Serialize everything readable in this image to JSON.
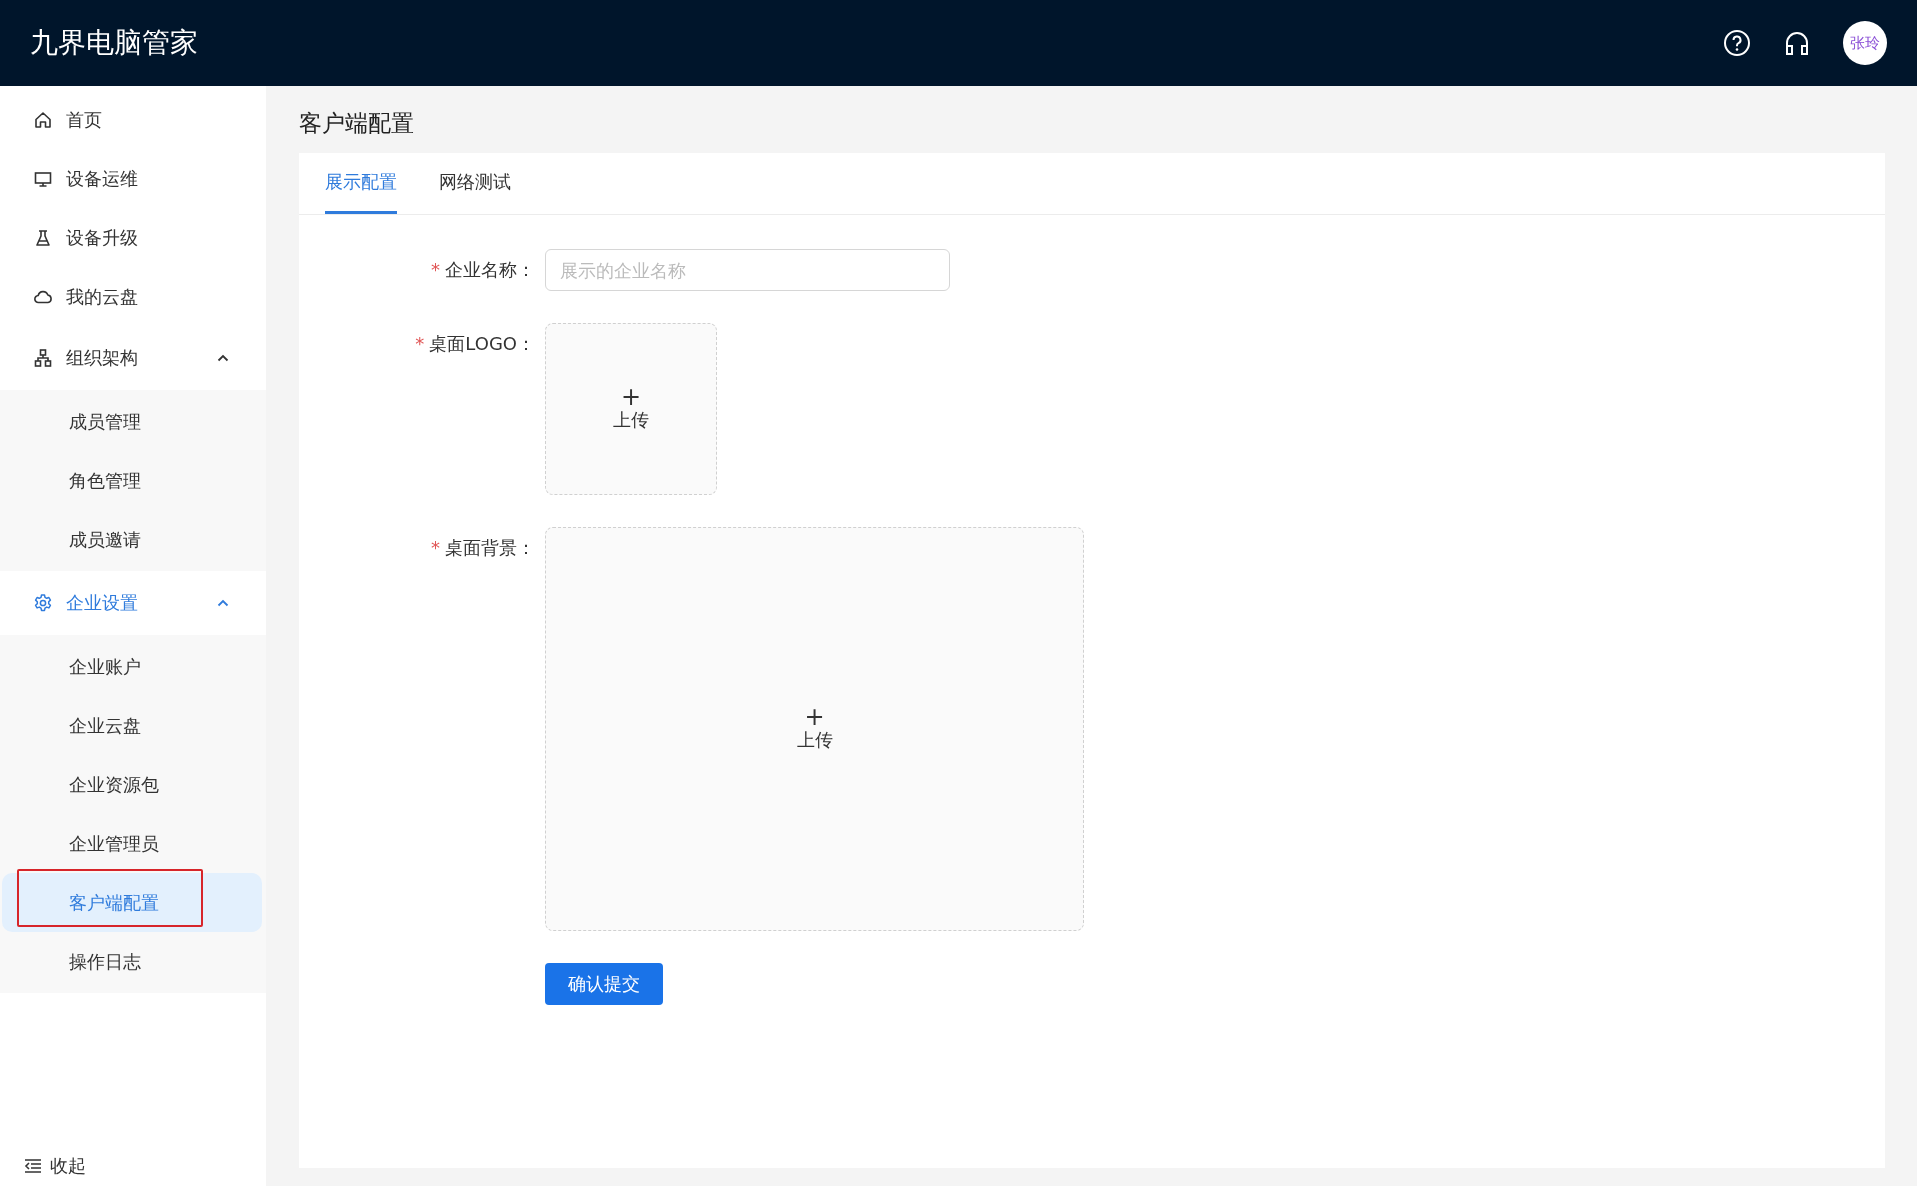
{
  "header": {
    "title": "九界电脑管家",
    "avatar": "张玲"
  },
  "sidebar": {
    "items": [
      {
        "label": "首页",
        "selected": false
      },
      {
        "label": "设备运维",
        "selected": false
      },
      {
        "label": "设备升级",
        "selected": false
      },
      {
        "label": "我的云盘",
        "selected": false
      },
      {
        "label": "组织架构",
        "selected": false,
        "expanded": true,
        "children": [
          {
            "label": "成员管理",
            "selected": false,
            "outlined": false
          },
          {
            "label": "角色管理",
            "selected": false,
            "outlined": false
          },
          {
            "label": "成员邀请",
            "selected": false,
            "outlined": false
          }
        ]
      },
      {
        "label": "企业设置",
        "selected": true,
        "expanded": true,
        "children": [
          {
            "label": "企业账户",
            "selected": false,
            "outlined": false
          },
          {
            "label": "企业云盘",
            "selected": false,
            "outlined": false
          },
          {
            "label": "企业资源包",
            "selected": false,
            "outlined": false
          },
          {
            "label": "企业管理员",
            "selected": false,
            "outlined": false
          },
          {
            "label": "客户端配置",
            "selected": true,
            "outlined": true
          },
          {
            "label": "操作日志",
            "selected": false,
            "outlined": false
          }
        ]
      }
    ],
    "collapse": "收起"
  },
  "page_title": "客户端配置",
  "tabs": [
    {
      "label": "展示配置",
      "selected": true
    },
    {
      "label": "网络测试",
      "selected": false
    }
  ],
  "form": {
    "fields": [
      {
        "kind": "input",
        "required": true,
        "label": "企业名称：",
        "placeholder": "展示的企业名称"
      },
      {
        "kind": "upload-square",
        "required": true,
        "label": "桌面LOGO：",
        "plus": "+",
        "text": "上传"
      },
      {
        "kind": "upload-wide",
        "required": true,
        "label": "桌面背景：",
        "plus": "+",
        "text": "上传"
      }
    ],
    "required_mark": "*",
    "submit": "确认提交"
  }
}
